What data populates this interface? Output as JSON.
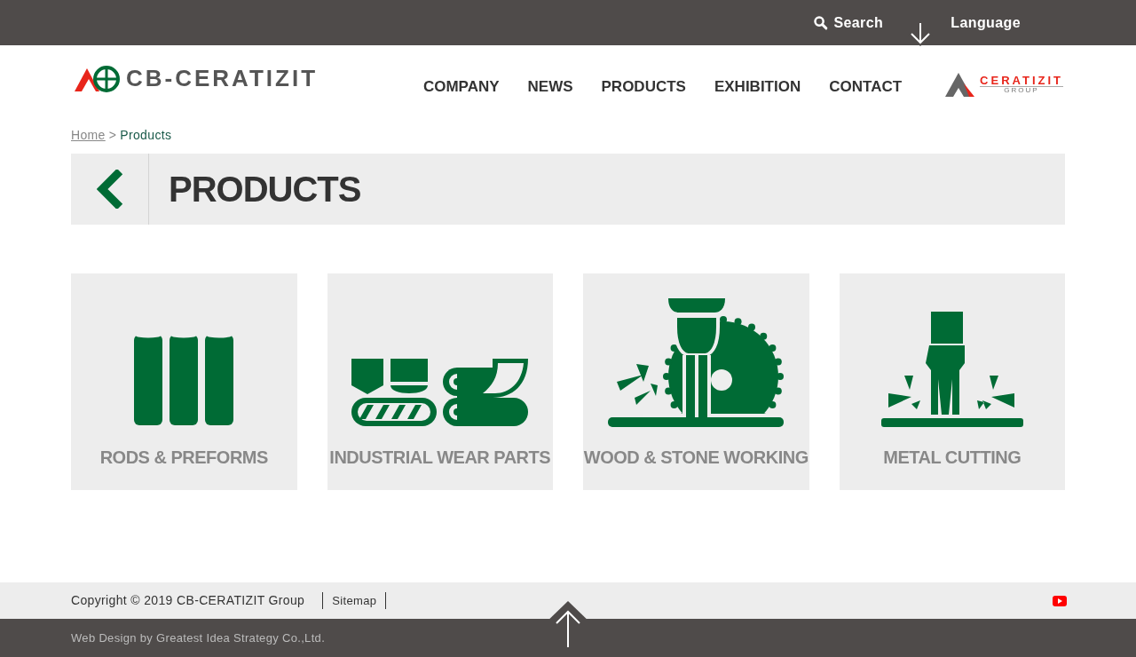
{
  "top_bar": {
    "search": "Search",
    "language": "Language"
  },
  "header": {
    "logo": "CB-CERATIZIT",
    "nav": [
      "COMPANY",
      "NEWS",
      "PRODUCTS",
      "EXHIBITION",
      "CONTACT"
    ],
    "group_logo": {
      "name": "CERATIZIT",
      "sub": "GROUP"
    }
  },
  "breadcrumb": {
    "home": "Home",
    "separator": ">",
    "current": "Products"
  },
  "page_title": "PRODUCTS",
  "products": [
    {
      "kind": "rods",
      "label": "RODS & PREFORMS"
    },
    {
      "kind": "wear",
      "label": "INDUSTRIAL WEAR PARTS"
    },
    {
      "kind": "wood",
      "label": "WOOD & STONE WORKING"
    },
    {
      "kind": "metal",
      "label": "METAL CUTTING"
    }
  ],
  "footer": {
    "copyright": "Copyright © 2019 CB-CERATIZIT Group",
    "sitemap": "Sitemap",
    "credit": "Web Design by Greatest Idea Strategy Co.,Ltd."
  }
}
